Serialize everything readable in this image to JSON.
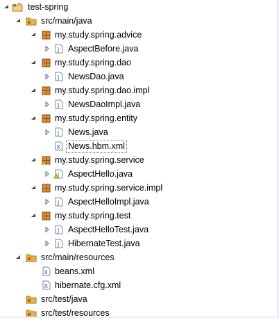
{
  "tree": {
    "project": {
      "label": "test-spring",
      "icon": "java-project-icon"
    },
    "src_main_java": {
      "label": "src/main/java",
      "icon": "source-folder-icon"
    },
    "pkg_advice": {
      "label": "my.study.spring.advice",
      "icon": "package-icon"
    },
    "file_aspect_before": {
      "label": "AspectBefore.java",
      "icon": "java-file-icon"
    },
    "pkg_dao": {
      "label": "my.study.spring.dao",
      "icon": "package-icon"
    },
    "file_news_dao": {
      "label": "NewsDao.java",
      "icon": "java-file-icon"
    },
    "pkg_dao_impl": {
      "label": "my.study.spring.dao.impl",
      "icon": "package-icon"
    },
    "file_news_dao_impl": {
      "label": "NewsDaoImpl.java",
      "icon": "java-file-icon"
    },
    "pkg_entity": {
      "label": "my.study.spring.entity",
      "icon": "package-icon"
    },
    "file_news": {
      "label": "News.java",
      "icon": "java-file-icon"
    },
    "file_news_hbm": {
      "label": "News.hbm.xml",
      "icon": "xml-file-icon"
    },
    "pkg_service": {
      "label": "my.study.spring.service",
      "icon": "package-warning-icon"
    },
    "file_aspect_hello": {
      "label": "AspectHello.java",
      "icon": "java-file-warning-icon"
    },
    "pkg_service_impl": {
      "label": "my.study.spring.service.impl",
      "icon": "package-icon"
    },
    "file_aspect_hello_impl": {
      "label": "AspectHelloImpl.java",
      "icon": "java-file-icon"
    },
    "pkg_test": {
      "label": "my.study.spring.test",
      "icon": "package-icon"
    },
    "file_aspect_hello_test": {
      "label": "AspectHelloTest.java",
      "icon": "java-file-icon"
    },
    "file_hibernate_test": {
      "label": "HibernateTest.java",
      "icon": "java-file-icon"
    },
    "src_main_resources": {
      "label": "src/main/resources",
      "icon": "source-folder-icon"
    },
    "file_beans_xml": {
      "label": "beans.xml",
      "icon": "xml-file-icon"
    },
    "file_hibernate_cfg": {
      "label": "hibernate.cfg.xml",
      "icon": "xml-file-icon"
    },
    "src_test_java": {
      "label": "src/test/java",
      "icon": "source-folder-icon"
    },
    "src_test_resources": {
      "label": "src/test/resources",
      "icon": "source-folder-icon"
    }
  },
  "colors": {
    "package": "#b5651d",
    "folder": "#e8b24a",
    "java_file": "#3c64b4",
    "warning": "#f0c030",
    "selection_border": "#777777"
  }
}
